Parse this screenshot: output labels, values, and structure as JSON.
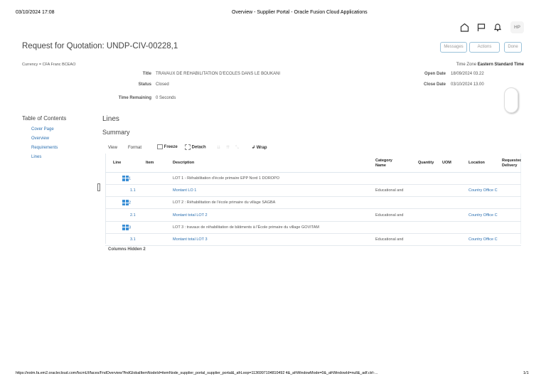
{
  "print_header": {
    "datetime": "03/10/2024 17:08",
    "title": "Overview - Supplier Portal - Oracle Fusion Cloud Applications"
  },
  "global": {
    "avatar": "HP"
  },
  "page": {
    "title": "Request for Quotation: UNDP-CIV-00228,1",
    "currency": "Currency = CFA Franc BCEAO"
  },
  "buttons": {
    "messages": "Messages",
    "actions": "Actions",
    "done": "Done"
  },
  "fields": {
    "title_label": "Title",
    "title_value": "TRAVAUX DE REHABILITATION D'ECOLES DANS LE BOUKANI",
    "status_label": "Status",
    "status_value": "Closed",
    "time_remaining_label": "Time Remaining",
    "time_remaining_value": "0 Seconds",
    "time_zone_label": "Time Zone",
    "time_zone_value": "Eastern Standard Time",
    "open_date_label": "Open Date",
    "open_date_value": "18/09/2024 03.22",
    "close_date_label": "Close Date",
    "close_date_value": "03/10/2024 13.00"
  },
  "toc": {
    "title": "Table of Contents",
    "items": [
      "Cover Page",
      "Overview",
      "Requirements",
      "Lines"
    ]
  },
  "lines": {
    "title": "Lines",
    "summary": "Summary",
    "toolbar": {
      "view": "View",
      "format": "Format",
      "freeze": "Freeze",
      "detach": "Detach",
      "wrap": "Wrap"
    },
    "columns": [
      "Line",
      "Item",
      "Description",
      "Category Name",
      "Quantity",
      "UOM",
      "Location",
      "Requested Delivery"
    ],
    "rows": [
      {
        "line": "1",
        "desc": "LOT 1 - Réhabilitation d'école primaire EPP Nord 1 DOROPO",
        "category": "",
        "location": "",
        "lot": true
      },
      {
        "line": "1.1",
        "desc": "Montant LO 1",
        "category": "Educational and",
        "location": "Country Office C",
        "lot": false
      },
      {
        "line": "2",
        "desc": "LOT 2 : Réhabilitation de l'école primaire du village SAGBA",
        "category": "",
        "location": "",
        "lot": true
      },
      {
        "line": "2.1",
        "desc": "Montant total LOT 2",
        "category": "Educational and",
        "location": "Country Office C",
        "lot": false
      },
      {
        "line": "3",
        "desc": "LOT 3 : travaux de réhabilitation de bâtiments à l'École primaire du village GOVITAM",
        "category": "",
        "location": "",
        "lot": true
      },
      {
        "line": "3.1",
        "desc": "Montant total LOT 3",
        "category": "Educational and",
        "location": "Country Office C",
        "lot": false
      }
    ],
    "columns_hidden_label": "Columns Hidden",
    "columns_hidden_value": "2"
  },
  "print_footer": {
    "url": "https://estm.fa.em2.oraclecloud.com/fscmUI/faces/FndOverview?fndGlobalItemNodeId=itemNode_supplier_portal_supplier_portal&_afrLoop=1136997104810492 4&_afrWindowMode=0&_afrWindowId=null&_adf.ctrl-...",
    "page": "1/1"
  }
}
